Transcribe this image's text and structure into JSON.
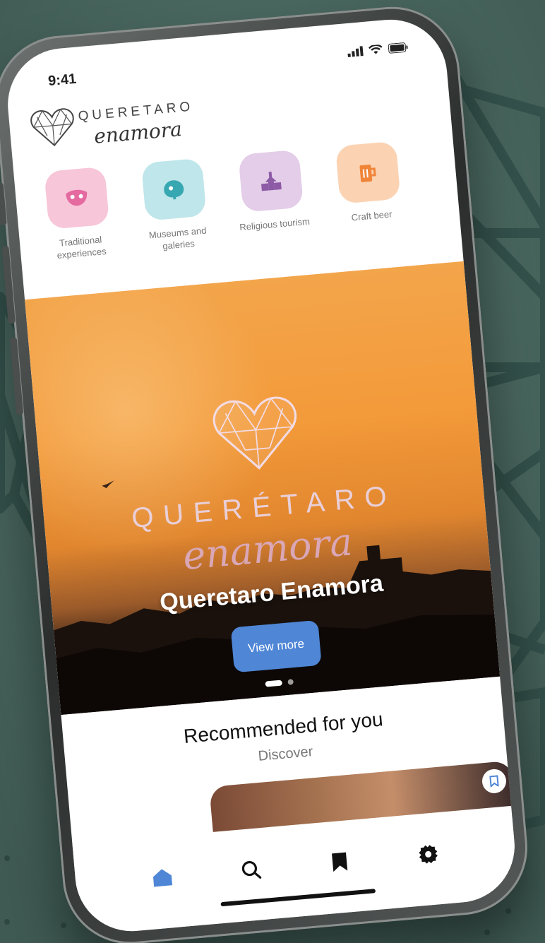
{
  "status_bar": {
    "time": "9:41"
  },
  "header": {
    "logo_top": "QUERETARO",
    "logo_script": "enamora"
  },
  "categories": [
    {
      "label": "Traditional experiences",
      "color": "#f7c6d8",
      "icon": "mask-icon",
      "icon_color": "#e46aa0"
    },
    {
      "label": "Museums and galeries",
      "color": "#bfe6ea",
      "icon": "museum-icon",
      "icon_color": "#37a7b1"
    },
    {
      "label": "Religious tourism",
      "color": "#e3cde8",
      "icon": "church-icon",
      "icon_color": "#8d5aa6"
    },
    {
      "label": "Craft beer",
      "color": "#fbd3b3",
      "icon": "beer-icon",
      "icon_color": "#f0853a"
    }
  ],
  "banner": {
    "logo_top": "QUERÉTARO",
    "logo_script": "enamora",
    "title": "Queretaro Enamora",
    "button_label": "View more",
    "button_color": "#4f86d6",
    "pages": 2,
    "active_page": 1
  },
  "recommended": {
    "title": "Recommended for you",
    "subtitle": "Discover"
  },
  "tab_bar": {
    "items": [
      {
        "name": "home-icon",
        "active": true
      },
      {
        "name": "search-icon",
        "active": false
      },
      {
        "name": "bookmark-icon",
        "active": false
      },
      {
        "name": "gear-icon",
        "active": false
      }
    ],
    "active_color": "#4f86d6",
    "inactive_color": "#111111"
  },
  "colors": {
    "background": "#4e6a62",
    "pattern": "#36504a"
  }
}
